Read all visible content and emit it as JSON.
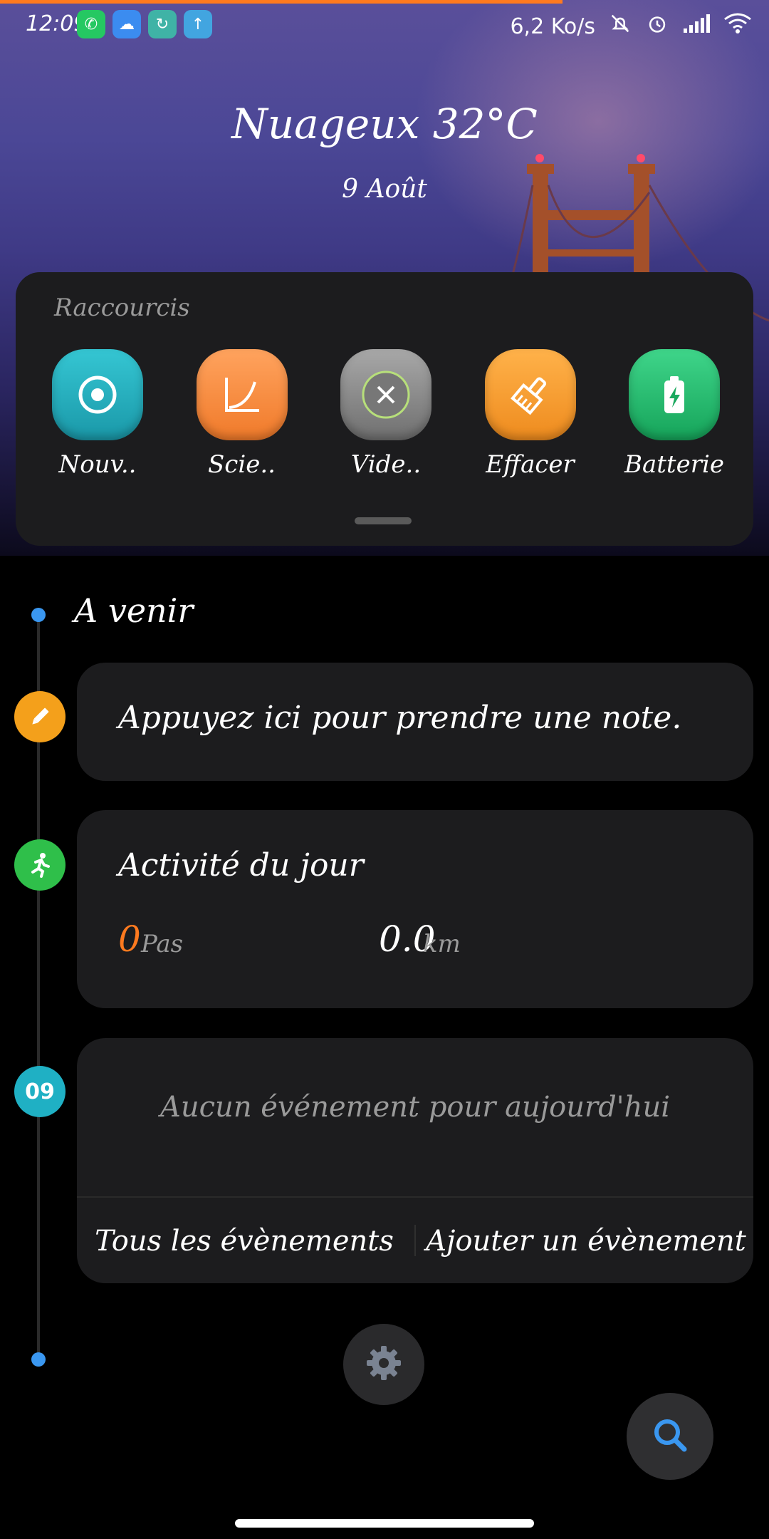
{
  "status_bar": {
    "time": "12:09",
    "network_speed": "6,2 Ko/s",
    "app_icons": [
      "whatsapp-icon",
      "cloud-download-icon",
      "sync-icon",
      "upload-icon"
    ],
    "right_icons": [
      "mute-notification-icon",
      "alarm-icon",
      "signal-icon",
      "wifi-icon"
    ]
  },
  "weather": {
    "text": "Nuageux 32°C",
    "date": "9 Août"
  },
  "shortcuts": {
    "title": "Raccourcis",
    "items": [
      {
        "label": "Nouv..",
        "icon": "record-icon",
        "color": "#1fa3b3"
      },
      {
        "label": "Scie..",
        "icon": "graph-icon",
        "color": "#f58a3d"
      },
      {
        "label": "Vide..",
        "icon": "close-icon",
        "color": "#8a8a8a"
      },
      {
        "label": "Effacer",
        "icon": "brush-icon",
        "color": "#f0942a"
      },
      {
        "label": "Batterie",
        "icon": "battery-icon",
        "color": "#22b86a"
      }
    ]
  },
  "timeline": {
    "section_title": "A venir",
    "note": {
      "text": "Appuyez ici pour prendre une note.",
      "badge_color": "#f4a01b"
    },
    "activity": {
      "title": "Activité du jour",
      "steps_value": "0",
      "steps_unit": "Pas",
      "distance_value": "0.0",
      "distance_unit": "km",
      "badge_color": "#2fbf4a"
    },
    "events": {
      "badge_day": "09",
      "badge_color": "#1fb0c4",
      "empty_text": "Aucun événement pour aujourd'hui",
      "all_events_label": "Tous les évènements",
      "add_event_label": "Ajouter un évènement"
    }
  },
  "colors": {
    "accent_orange": "#ff7a1f",
    "timeline_dot": "#3a97f0",
    "search_icon": "#3a97f0"
  }
}
